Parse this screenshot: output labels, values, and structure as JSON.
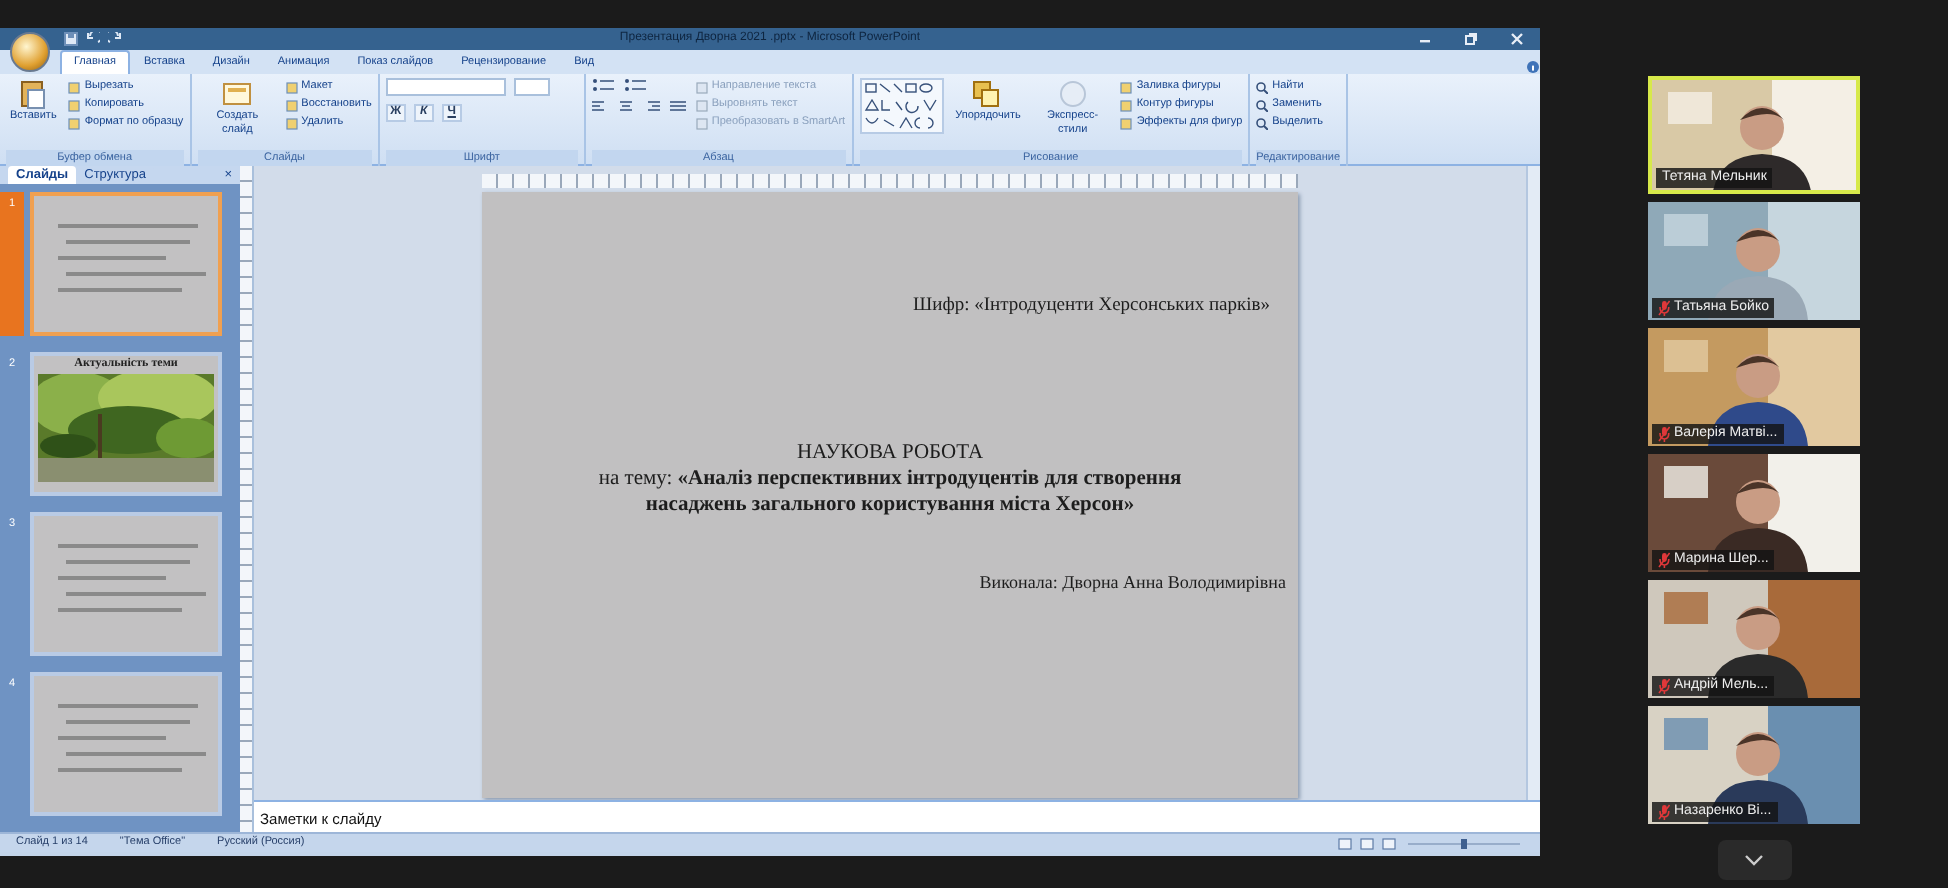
{
  "window": {
    "title": "Презентация Дворна 2021 .pptx - Microsoft PowerPoint"
  },
  "ribbon": {
    "tabs": [
      {
        "label": "Главная",
        "selected": true
      },
      {
        "label": "Вставка",
        "selected": false
      },
      {
        "label": "Дизайн",
        "selected": false
      },
      {
        "label": "Анимация",
        "selected": false
      },
      {
        "label": "Показ слайдов",
        "selected": false
      },
      {
        "label": "Рецензирование",
        "selected": false
      },
      {
        "label": "Вид",
        "selected": false
      }
    ],
    "groups": [
      {
        "kind": "clipboard",
        "label": "Буфер обмена",
        "large": [
          "Вставить"
        ],
        "small": [
          "Вырезать",
          "Копировать",
          "Формат по образцу"
        ]
      },
      {
        "kind": "slides",
        "label": "Слайды",
        "large": [
          "Создать слайд"
        ],
        "small": [
          "Макет",
          "Восстановить",
          "Удалить"
        ]
      },
      {
        "kind": "font",
        "label": "Шрифт",
        "tools": [
          "Ж",
          "К",
          "Ч"
        ]
      },
      {
        "kind": "paragraph",
        "label": "Абзац",
        "small": [
          "Направление текста",
          "Выровнять текст",
          "Преобразовать в SmartArt"
        ]
      },
      {
        "kind": "drawing",
        "label": "Рисование",
        "large": [
          "Упорядочить",
          "Экспресс-стили"
        ],
        "small": [
          "Заливка фигуры",
          "Контур фигуры",
          "Эффекты для фигур"
        ]
      },
      {
        "kind": "editing",
        "label": "Редактирование",
        "small": [
          "Найти",
          "Заменить",
          "Выделить"
        ]
      }
    ]
  },
  "slides_panel": {
    "tabs": [
      {
        "label": "Слайды",
        "selected": true
      },
      {
        "label": "Структура",
        "selected": false
      }
    ],
    "close": "×",
    "thumbnails": [
      {
        "number": "1",
        "selected": true,
        "kind": "text"
      },
      {
        "number": "2",
        "selected": false,
        "kind": "picture",
        "title": "Актуальність теми"
      },
      {
        "number": "3",
        "selected": false,
        "kind": "text"
      },
      {
        "number": "4",
        "selected": false,
        "kind": "text"
      }
    ]
  },
  "slide": {
    "cipher": "Шифр: «Інтродуценти Херсонських парків»",
    "heading": "НАУКОВА РОБОТА",
    "topic": "на тему: **«Аналіз перспективних інтродуцентів для створення насаджень загального користування міста Херсон»**",
    "author": "Виконала: Дворна Анна Володимирівна"
  },
  "notes": "Заметки к слайду",
  "status_bar": [
    "Слайд 1 из 14",
    "\"Тема Office\"",
    "Русский (Россия)"
  ],
  "zoom_slider": {
    "level": 0.5
  },
  "participants": [
    {
      "name": "Тетяна Мельник",
      "muted": false,
      "active": true
    },
    {
      "name": "Татьяна Бойко",
      "muted": true,
      "active": false
    },
    {
      "name": "Валерія Матві...",
      "muted": true,
      "active": false
    },
    {
      "name": "Марина Шер...",
      "muted": true,
      "active": false
    },
    {
      "name": "Андрій Мель...",
      "muted": true,
      "active": false
    },
    {
      "name": "Назаренко Ві...",
      "muted": true,
      "active": false
    }
  ]
}
